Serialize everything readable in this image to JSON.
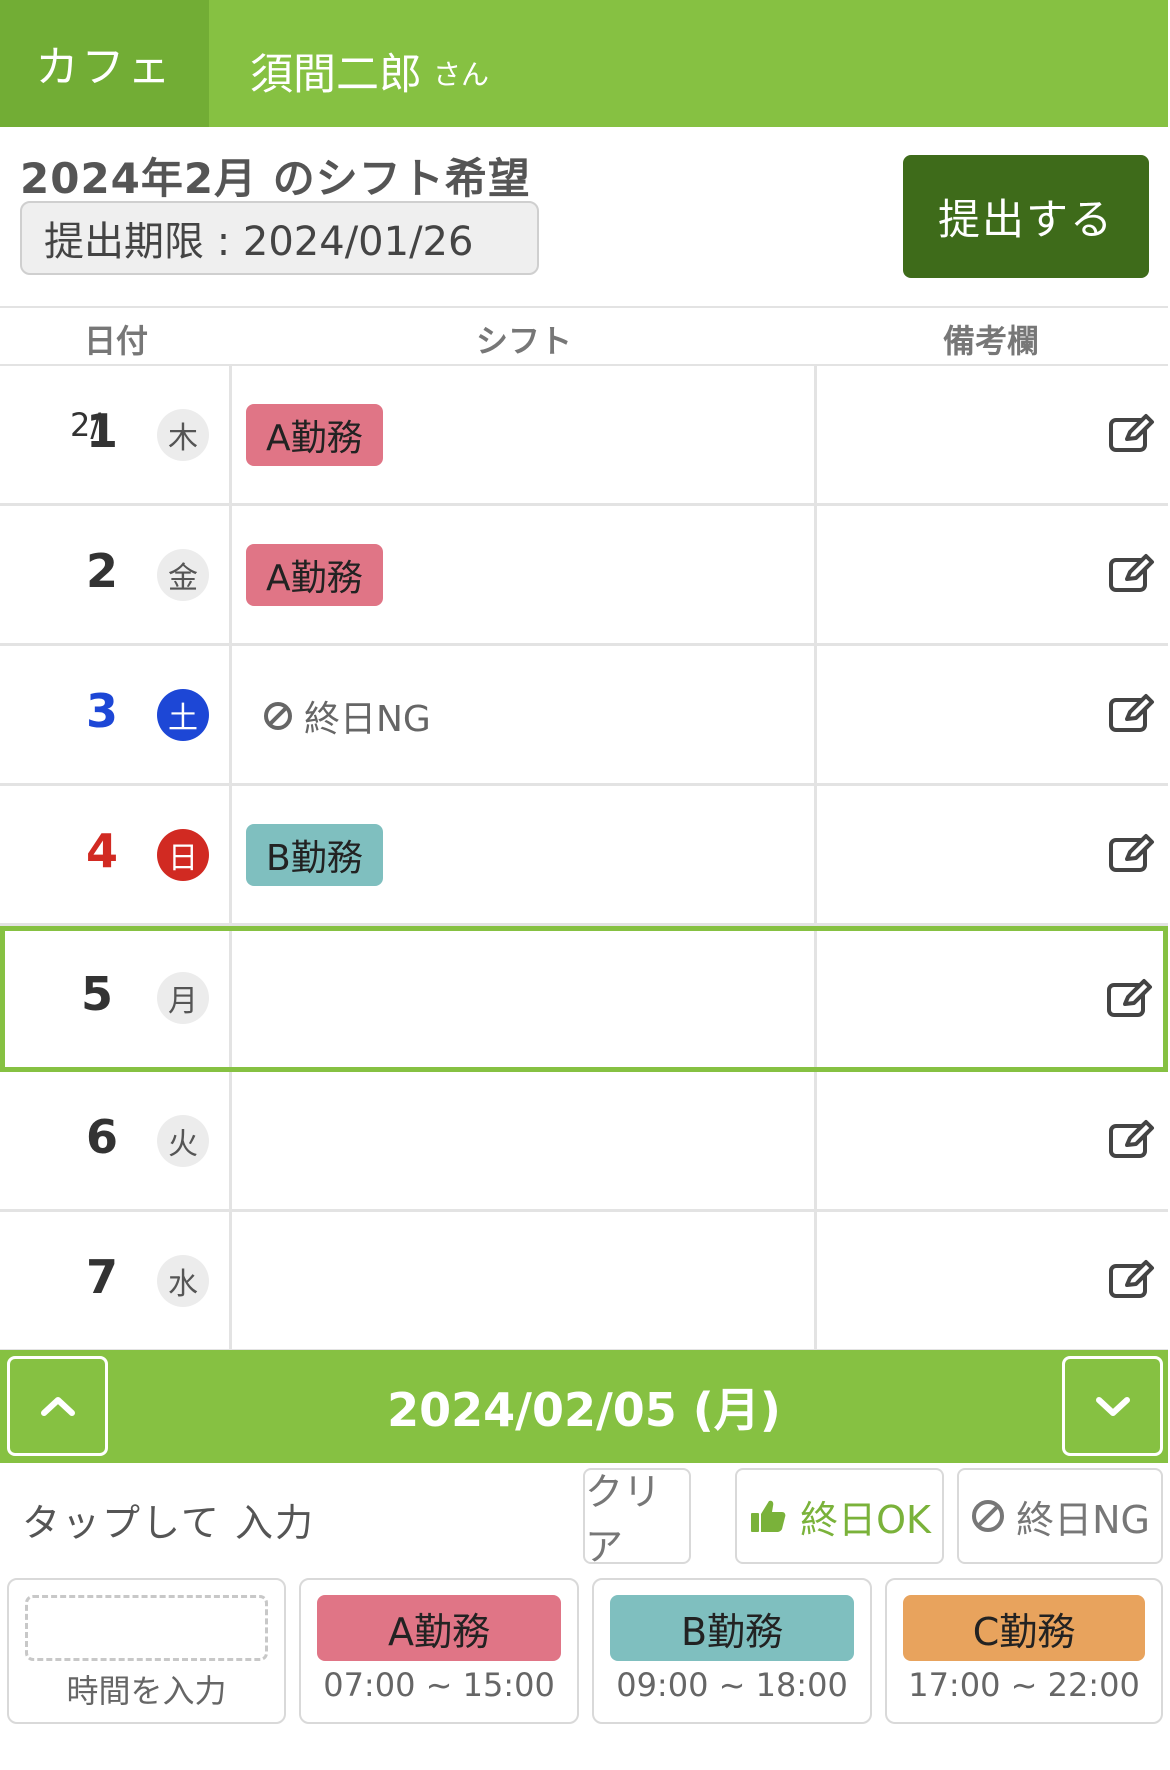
{
  "header": {
    "store": "カフェ",
    "user_name": "須間二郎",
    "user_suffix": "さん"
  },
  "page": {
    "title": "2024年2月 のシフト希望",
    "deadline": "提出期限 : 2024/01/26",
    "submit_label": "提出する"
  },
  "columns": {
    "date": "日付",
    "shift": "シフト",
    "notes": "備考欄"
  },
  "rows": [
    {
      "month": "2/",
      "day": "1",
      "dow": "木",
      "shift": "A勤務"
    },
    {
      "day": "2",
      "dow": "金",
      "shift": "A勤務"
    },
    {
      "day": "3",
      "dow": "土",
      "shift": "終日NG"
    },
    {
      "day": "4",
      "dow": "日",
      "shift": "B勤務"
    },
    {
      "day": "5",
      "dow": "月",
      "shift": ""
    },
    {
      "day": "6",
      "dow": "火",
      "shift": ""
    },
    {
      "day": "7",
      "dow": "水",
      "shift": ""
    }
  ],
  "selected_row": 4,
  "nav": {
    "current_date": "2024/02/05 (月)"
  },
  "input": {
    "tap_label": "タップして 入力",
    "clear_label": "クリア",
    "all_day_ok_label": "終日OK",
    "all_day_ng_label": "終日NG"
  },
  "patterns": [
    {
      "name": "",
      "time": "時間を入力"
    },
    {
      "name": "A勤務",
      "time": "07:00 ~ 15:00",
      "color": "#e07586"
    },
    {
      "name": "B勤務",
      "time": "09:00 ~ 18:00",
      "color": "#7fbfbf"
    },
    {
      "name": "C勤務",
      "time": "17:00 ~ 22:00",
      "color": "#e8a35d"
    }
  ],
  "colors": {
    "brand_green": "#86c142",
    "dark_green": "#3e6b1a",
    "saturday": "#1d47d6",
    "sunday": "#d12a22"
  }
}
